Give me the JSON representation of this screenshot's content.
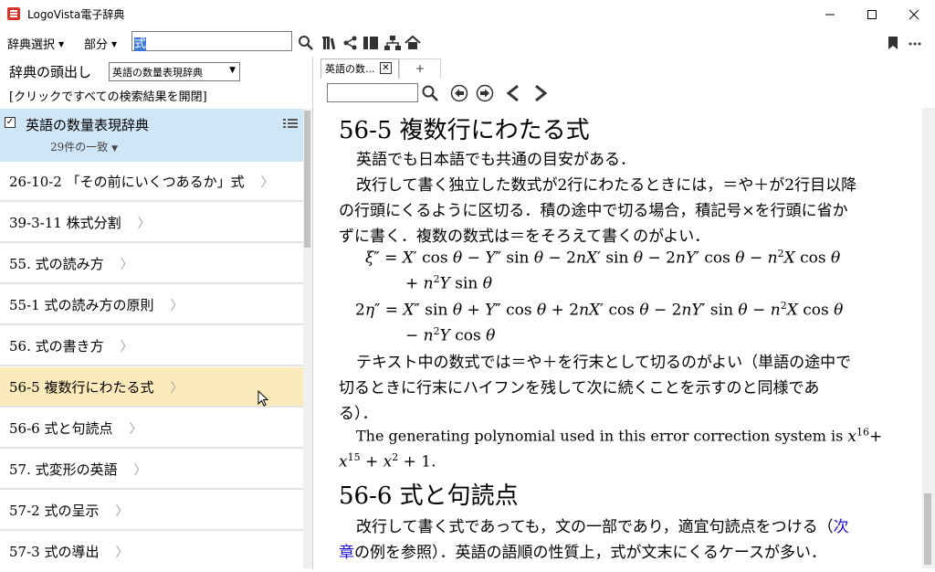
{
  "window": {
    "title": "LogoVista電子辞典"
  },
  "toolbar": {
    "dict_select_label": "辞典選択",
    "partial_label": "部分",
    "search_value": "式"
  },
  "left": {
    "head_label": "辞典の頭出し",
    "dict_selector_value": "英語の数量表現辞典",
    "open_all_label": "[クリックですべての検索結果を開閉]",
    "dict_name": "英語の数量表現辞典",
    "match_count": "29件の一致",
    "results": [
      "26-10-2 「その前にいくつあるか」式",
      "39-3-11 株式分割",
      "55. 式の読み方",
      "55-1 式の読み方の原則",
      "56. 式の書き方",
      "56-5 複数行にわたる式",
      "56-6 式と句読点",
      "57. 式変形の英語",
      "57-2 式の呈示",
      "57-3 式の導出"
    ]
  },
  "tabs": {
    "active_label": "英語の数...",
    "new_tab": "+"
  },
  "content": {
    "h1": "56-5 複数行にわたる式",
    "p1": "英語でも日本語でも共通の目安がある．",
    "p2_l1": "改行して書く独立した数式が2行にわたるときには，＝や＋が2行目以降",
    "p2_l2": "の行頭にくるように区切る．積の途中で切る場合，積記号×を行頭に省か",
    "p2_l3": "ずに書く．複数の数式は＝をそろえて書くのがよい．",
    "p3_l1": "テキスト中の数式では＝や＋を行末として切るのがよい（単語の途中で",
    "p3_l2": "切るときに行末にハイフンを残して次に続くことを示すのと同様であ",
    "p3_l3": "る）．",
    "p4_l1": "The generating polynomial used in this error correction system is",
    "h2": "56-6 式と句読点",
    "p5_l1a": "改行して書く式であっても，文の一部であり，適宜句読点をつける（",
    "p5_link1": "次",
    "p5_link2": "章",
    "p5_l2b": "の例を参照）．英語の語順の性質上，式が文末にくるケースが多い．"
  }
}
